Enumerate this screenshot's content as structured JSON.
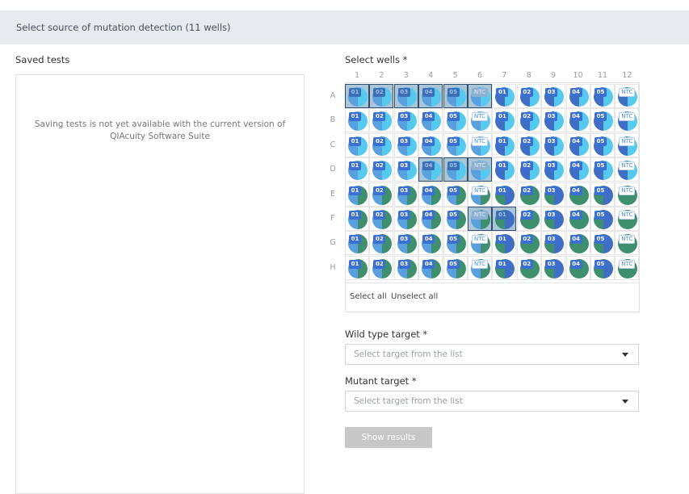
{
  "header": {
    "title": "Select source of mutation detection (11 wells)"
  },
  "saved_tests": {
    "title": "Saved tests",
    "message": "Saving tests is not yet available with the current version of QIAcuity Software Suite"
  },
  "wells": {
    "title": "Select wells *",
    "columns": [
      "1",
      "2",
      "3",
      "4",
      "5",
      "6",
      "7",
      "8",
      "9",
      "10",
      "11",
      "12"
    ],
    "rows": [
      "A",
      "B",
      "C",
      "D",
      "E",
      "F",
      "G",
      "H"
    ],
    "well_labels": [
      "01",
      "02",
      "03",
      "04",
      "05",
      "NTC",
      "01",
      "02",
      "03",
      "04",
      "05",
      "NTC"
    ],
    "selected": [
      "A1",
      "A2",
      "A3",
      "A4",
      "A5",
      "A6",
      "D4",
      "D5",
      "D6",
      "F6",
      "F7"
    ],
    "colors": {
      "wild_type": "#5aa0de",
      "mutant": "#56c9ee",
      "green": "#3d8f6e",
      "dark_blue": "#3f6ec4"
    },
    "select_all": "Select all",
    "unselect_all": "Unselect all"
  },
  "wild_type": {
    "label": "Wild type target *",
    "placeholder": "Select target from the list"
  },
  "mutant": {
    "label": "Mutant target *",
    "placeholder": "Select target from the list"
  },
  "show_results": "Show results"
}
